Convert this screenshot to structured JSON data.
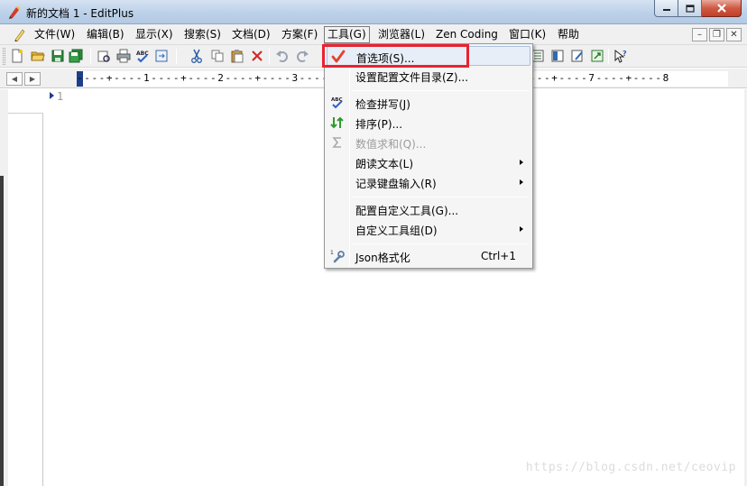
{
  "window": {
    "title": "新的文档 1 - EditPlus"
  },
  "menubar": {
    "items": [
      {
        "label": "文件(W)"
      },
      {
        "label": "编辑(B)"
      },
      {
        "label": "显示(X)"
      },
      {
        "label": "搜索(S)"
      },
      {
        "label": "文档(D)"
      },
      {
        "label": "方案(F)"
      },
      {
        "label": "工具(G)"
      },
      {
        "label": "浏览器(L)"
      },
      {
        "label": "Zen Coding"
      },
      {
        "label": "窗口(K)"
      },
      {
        "label": "帮助"
      }
    ],
    "active_item": "工具(G)"
  },
  "ruler": {
    "text": "----+----1----+----2----+----3----+----4----+----5----+----6----+----7----+----8"
  },
  "editor": {
    "line_numbers": [
      "1"
    ]
  },
  "tools_menu": {
    "items": [
      {
        "label": "首选项(S)...",
        "icon": "checkmark-icon",
        "highlighted": true
      },
      {
        "label": "设置配置文件目录(Z)..."
      },
      {
        "label": "检查拼写(J)",
        "icon": "spellcheck-icon"
      },
      {
        "label": "排序(P)...",
        "icon": "sort-icon"
      },
      {
        "label": "数值求和(Q)...",
        "icon": "sigma-icon",
        "disabled": true
      },
      {
        "label": "朗读文本(L)",
        "submenu": true
      },
      {
        "label": "记录键盘输入(R)",
        "submenu": true
      },
      {
        "label": "配置自定义工具(G)..."
      },
      {
        "label": "自定义工具组(D)",
        "submenu": true
      },
      {
        "label": "Json格式化",
        "icon": "wrench-icon",
        "shortcut": "Ctrl+1"
      }
    ]
  },
  "watermark": "https://blog.csdn.net/ceovip",
  "colors": {
    "highlight_border": "#e8232f",
    "checkmark": "#e8402f",
    "ruler_cursor": "#1c3f8c"
  }
}
